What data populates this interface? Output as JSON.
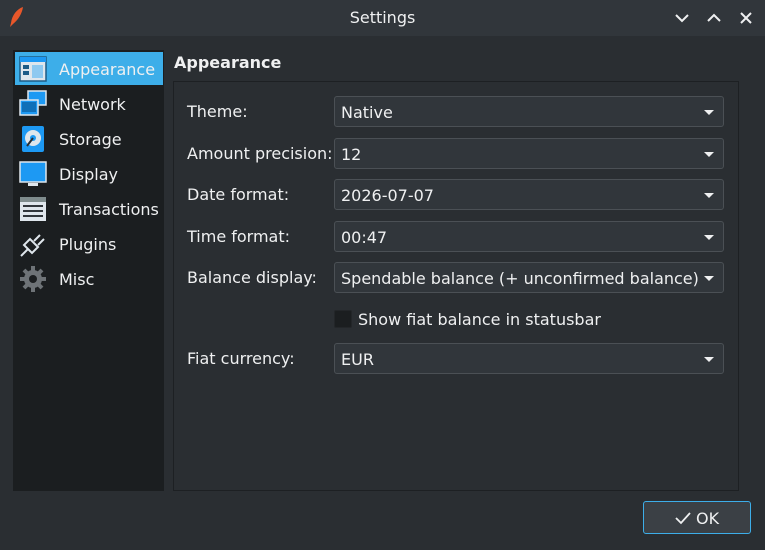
{
  "window": {
    "title": "Settings"
  },
  "sidebar": {
    "items": [
      {
        "label": "Appearance",
        "icon": "appearance-icon",
        "active": true
      },
      {
        "label": "Network",
        "icon": "network-icon",
        "active": false
      },
      {
        "label": "Storage",
        "icon": "storage-icon",
        "active": false
      },
      {
        "label": "Display",
        "icon": "display-icon",
        "active": false
      },
      {
        "label": "Transactions",
        "icon": "transactions-icon",
        "active": false
      },
      {
        "label": "Plugins",
        "icon": "plugins-icon",
        "active": false
      },
      {
        "label": "Misc",
        "icon": "gear-icon",
        "active": false
      }
    ]
  },
  "page": {
    "title": "Appearance",
    "fields": [
      {
        "label": "Theme:",
        "value": "Native"
      },
      {
        "label": "Amount precision:",
        "value": "12"
      },
      {
        "label": "Date format:",
        "value": "2026-07-07"
      },
      {
        "label": "Time format:",
        "value": "00:47"
      },
      {
        "label": "Balance display:",
        "value": "Spendable balance (+ unconfirmed balance)"
      }
    ],
    "checkbox": {
      "label": "Show fiat balance in statusbar",
      "checked": false
    },
    "fiat": {
      "label": "Fiat currency:",
      "value": "EUR"
    }
  },
  "buttons": {
    "ok": "OK"
  },
  "colors": {
    "accent": "#3daee9",
    "background": "#2a2e32",
    "sidebar": "#1b1e20"
  }
}
